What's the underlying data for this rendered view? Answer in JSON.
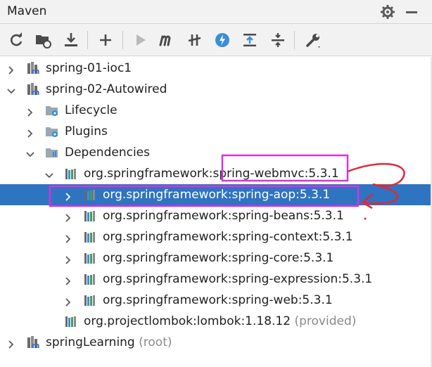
{
  "header": {
    "title": "Maven",
    "settings_icon": "gear-icon",
    "minimize_icon": "minimize-icon"
  },
  "toolbar": {
    "icons": [
      "reload-icon",
      "folder-reimport-icon",
      "download-icon",
      "add-icon",
      "run-icon",
      "maven-goal-icon",
      "skip-tests-icon",
      "offline-icon",
      "collapse-all-icon",
      "expand-all-icon",
      "settings-wrench-icon"
    ]
  },
  "tree": {
    "rows": [
      {
        "label": "spring-01-ioc1",
        "suffix": "",
        "expanded": false,
        "icon": "maven-module-icon"
      },
      {
        "label": "spring-02-Autowired",
        "suffix": "",
        "expanded": true,
        "icon": "maven-module-icon"
      },
      {
        "label": "Lifecycle",
        "suffix": "",
        "expanded": false,
        "icon": "folder-gear-icon"
      },
      {
        "label": "Plugins",
        "suffix": "",
        "expanded": false,
        "icon": "folder-gear-icon"
      },
      {
        "label": "Dependencies",
        "suffix": "",
        "expanded": true,
        "icon": "folder-library-icon"
      },
      {
        "label": "org.springframework:spring-webmvc:5.3.1",
        "suffix": "",
        "expanded": true,
        "icon": "library-icon"
      },
      {
        "label": "org.springframework:spring-aop:5.3.1",
        "suffix": "",
        "expanded": false,
        "icon": "library-icon",
        "selected": true
      },
      {
        "label": "org.springframework:spring-beans:5.3.1",
        "suffix": "",
        "expanded": false,
        "icon": "library-icon"
      },
      {
        "label": "org.springframework:spring-context:5.3.1",
        "suffix": "",
        "expanded": false,
        "icon": "library-icon"
      },
      {
        "label": "org.springframework:spring-core:5.3.1",
        "suffix": "",
        "expanded": false,
        "icon": "library-icon"
      },
      {
        "label": "org.springframework:spring-expression:5.3.1",
        "suffix": "",
        "expanded": false,
        "icon": "library-icon"
      },
      {
        "label": "org.springframework:spring-web:5.3.1",
        "suffix": "",
        "expanded": false,
        "icon": "library-icon"
      },
      {
        "label": "org.projectlombok:lombok:1.18.12",
        "suffix": "(provided)",
        "expanded": false,
        "icon": "library-icon"
      },
      {
        "label": "springLearning",
        "suffix": "(root)",
        "expanded": false,
        "icon": "maven-module-icon"
      }
    ]
  },
  "colors": {
    "selection": "#2f74c0",
    "annotation": "#d633e0",
    "arrow": "#e0283a",
    "text": "#1f1f1f",
    "muted": "#8a8a8a"
  }
}
